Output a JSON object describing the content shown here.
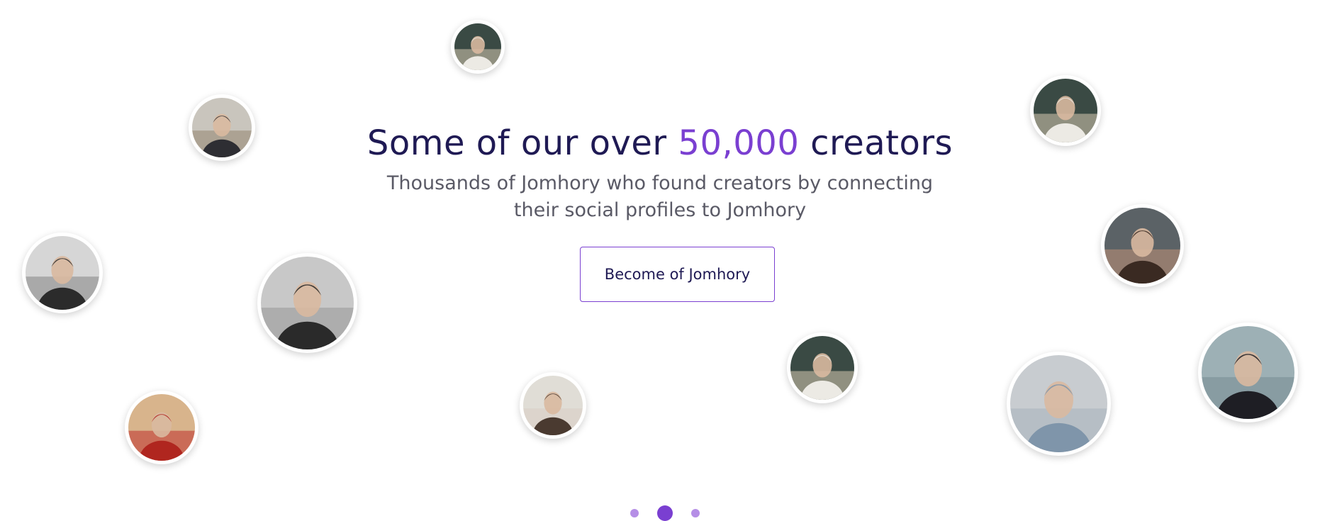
{
  "hero": {
    "title_before": "Some of our over ",
    "title_highlight": "50,000",
    "title_after": " creators",
    "subtitle": "Thousands of Jomhory who found creators by connecting their social profiles to Jomhory",
    "cta_label": "Become of Jomhory"
  },
  "colors": {
    "heading": "#1f1a54",
    "accent": "#7a3fd1",
    "subtitle": "#5a5a66",
    "dot_inactive": "#b58ee6"
  },
  "carousel": {
    "slides": 3,
    "active_index": 1
  },
  "avatars": [
    {
      "name": "creator-hoodie-stairs-1",
      "tone": "#c9c0a8",
      "fg": "#eceae4",
      "bg2": "#3a4a44"
    },
    {
      "name": "creator-jacket-street",
      "tone": "#9a8a76",
      "fg": "#2e2e33",
      "bg2": "#c9c5bd"
    },
    {
      "name": "creator-hoodie-stairs-2",
      "tone": "#c9c0a8",
      "fg": "#eceae4",
      "bg2": "#3a4a44"
    },
    {
      "name": "creator-bw-portrait-man",
      "tone": "#8a8a8a",
      "fg": "#2b2b2b",
      "bg2": "#d6d6d6"
    },
    {
      "name": "creator-bw-curly-hair",
      "tone": "#9b9b9b",
      "fg": "#2a2a2a",
      "bg2": "#c8c8c8"
    },
    {
      "name": "creator-bearded-shirtless",
      "tone": "#b98d74",
      "fg": "#3a2a22",
      "bg2": "#5b6266"
    },
    {
      "name": "creator-hoodie-stairs-3",
      "tone": "#c9c0a8",
      "fg": "#eceae4",
      "bg2": "#3a4a44"
    },
    {
      "name": "creator-red-hoodie",
      "tone": "#c23b33",
      "fg": "#b0261f",
      "bg2": "#d8b48c"
    },
    {
      "name": "creator-woman-closeup",
      "tone": "#d8cfc4",
      "fg": "#4a3a30",
      "bg2": "#e0ddd6"
    },
    {
      "name": "creator-sunglasses-denim",
      "tone": "#aab4be",
      "fg": "#7f95aa",
      "bg2": "#c8ccd0"
    },
    {
      "name": "creator-woman-dark-hair",
      "tone": "#7a8f96",
      "fg": "#1e1e24",
      "bg2": "#9db0b5"
    }
  ]
}
